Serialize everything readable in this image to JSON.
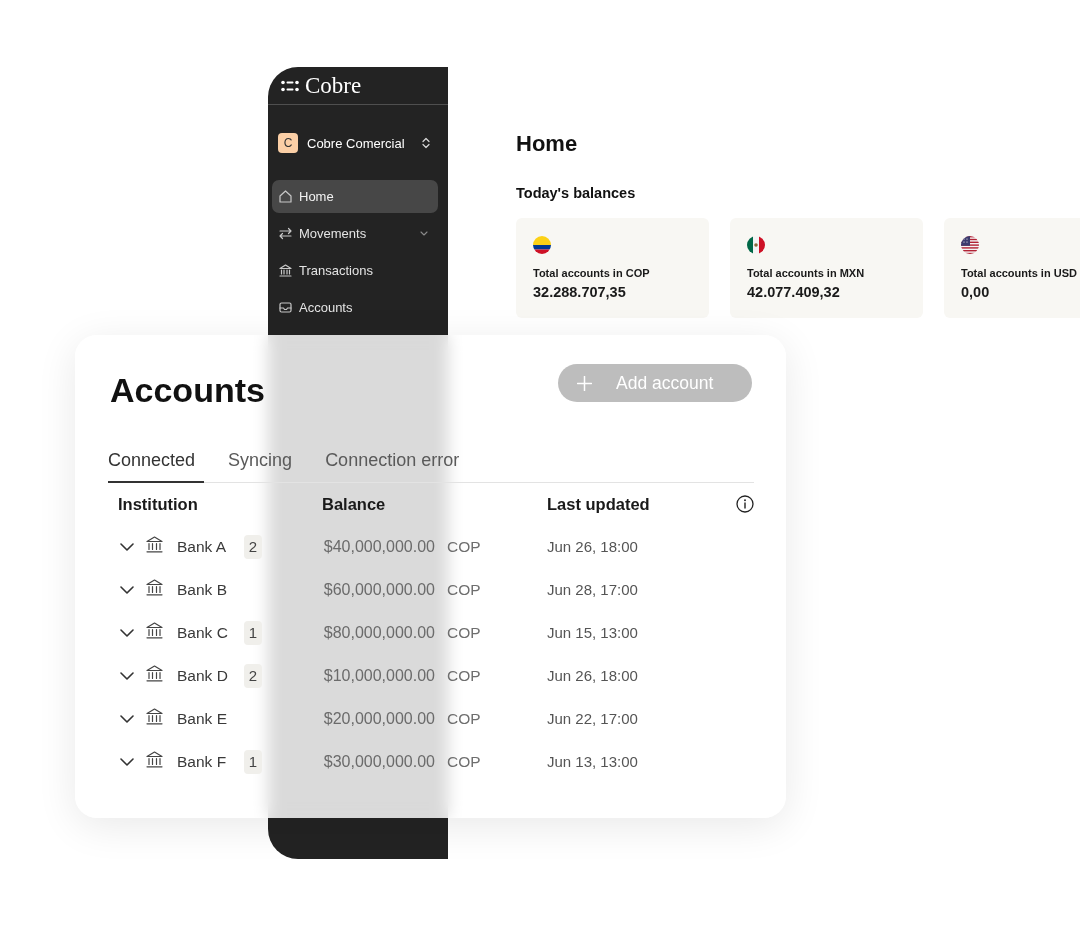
{
  "sidebar": {
    "logo": "Cobre",
    "workspace": {
      "initial": "C",
      "name": "Cobre Comercial"
    },
    "items": [
      {
        "label": "Home",
        "selected": true,
        "expandable": false
      },
      {
        "label": "Movements",
        "selected": false,
        "expandable": true
      },
      {
        "label": "Transactions",
        "selected": false,
        "expandable": false
      },
      {
        "label": "Accounts",
        "selected": false,
        "expandable": false
      }
    ]
  },
  "home": {
    "title": "Home",
    "section_title": "Today's balances",
    "balances": [
      {
        "label": "Total accounts in COP",
        "value": "32.288.707,35"
      },
      {
        "label": "Total accounts in MXN",
        "value": "42.077.409,32"
      },
      {
        "label": "Total accounts in USD",
        "value": "0,00"
      }
    ]
  },
  "accounts": {
    "title": "Accounts",
    "add_button": "Add account",
    "tabs": [
      {
        "label": "Connected",
        "selected": true
      },
      {
        "label": "Syncing",
        "selected": false
      },
      {
        "label": "Connection error",
        "selected": false
      }
    ],
    "columns": [
      "Institution",
      "Balance",
      "Last updated"
    ],
    "rows": [
      {
        "name": "Bank A",
        "count": "2",
        "balance": "$40,000,000.00",
        "currency": "COP",
        "updated": "Jun 26, 18:00"
      },
      {
        "name": "Bank B",
        "balance": "$60,000,000.00",
        "currency": "COP",
        "updated": "Jun 28, 17:00"
      },
      {
        "name": "Bank C",
        "count": "1",
        "balance": "$80,000,000.00",
        "currency": "COP",
        "updated": "Jun 15, 13:00"
      },
      {
        "name": "Bank D",
        "count": "2",
        "balance": "$10,000,000.00",
        "currency": "COP",
        "updated": "Jun 26, 18:00"
      },
      {
        "name": "Bank E",
        "balance": "$20,000,000.00",
        "currency": "COP",
        "updated": "Jun 22, 17:00"
      },
      {
        "name": "Bank F",
        "count": "1",
        "balance": "$30,000,000.00",
        "currency": "COP",
        "updated": "Jun 13, 13:00"
      }
    ]
  }
}
